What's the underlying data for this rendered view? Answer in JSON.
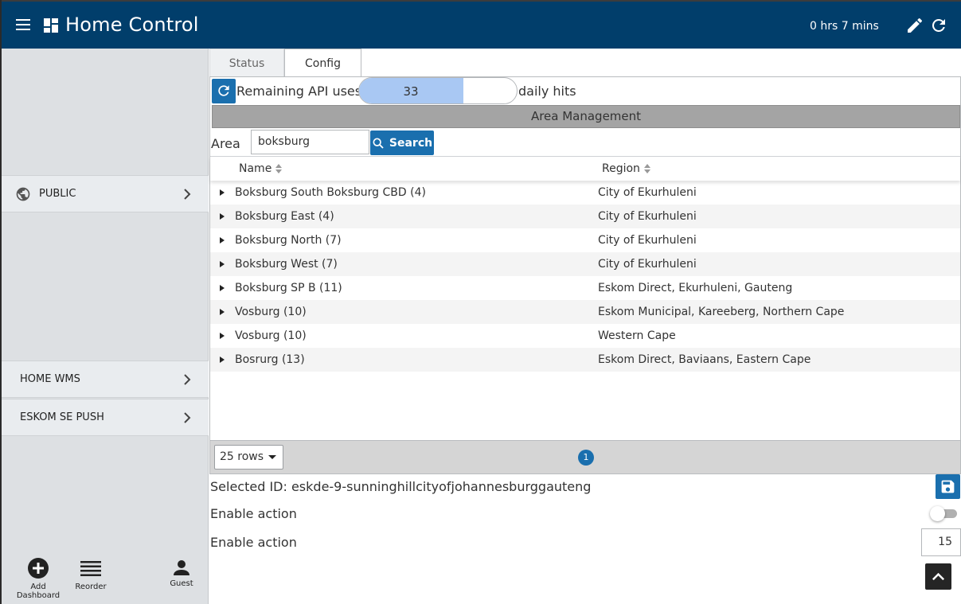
{
  "header": {
    "title": "Home Control",
    "timer": "0 hrs 7 mins",
    "icons": [
      "menu-icon",
      "dashboard-icon",
      "pencil-icon",
      "refresh-icon"
    ]
  },
  "sidebar": {
    "items": [
      {
        "label": "PUBLIC",
        "icon": "globe-icon"
      },
      {
        "label": "HOME WMS"
      },
      {
        "label": "ESKOM SE PUSH"
      }
    ],
    "tools": [
      {
        "label": "Add Dashboard",
        "icon": "add-circle-icon"
      },
      {
        "label": "Reorder",
        "icon": "reorder-icon"
      },
      {
        "label": "Guest",
        "icon": "person-icon"
      }
    ]
  },
  "tabs": [
    {
      "label": "Status",
      "active": false
    },
    {
      "label": "Config",
      "active": true
    }
  ],
  "api": {
    "label": "Remaining API uses:",
    "value": "33",
    "fill_fraction": 0.66,
    "suffix": "daily hits"
  },
  "area": {
    "header": "Area Management",
    "label": "Area",
    "input_value": "boksburg",
    "search_label": "Search"
  },
  "table": {
    "columns": [
      "Name",
      "Region"
    ],
    "rows": [
      {
        "name": "Boksburg South Boksburg CBD (4)",
        "region": "City of Ekurhuleni"
      },
      {
        "name": "Boksburg East (4)",
        "region": "City of Ekurhuleni"
      },
      {
        "name": "Boksburg North (7)",
        "region": "City of Ekurhuleni"
      },
      {
        "name": "Boksburg West (7)",
        "region": "City of Ekurhuleni"
      },
      {
        "name": "Boksburg SP B (11)",
        "region": "Eskom Direct, Ekurhuleni, Gauteng"
      },
      {
        "name": "Vosburg (10)",
        "region": "Eskom Municipal, Kareeberg, Northern Cape"
      },
      {
        "name": "Vosburg (10)",
        "region": "Western Cape"
      },
      {
        "name": "Bosrurg (13)",
        "region": "Eskom Direct, Baviaans, Eastern Cape"
      }
    ]
  },
  "pager": {
    "rows_label": "25 rows",
    "page": "1"
  },
  "config": {
    "selected_id": "Selected ID: eskde-9-sunninghillcityofjohannesburggauteng",
    "enable_label_1": "Enable action",
    "enable_label_2": "Enable action",
    "toggle_on": false,
    "number_value": "15"
  },
  "colors": {
    "header_bg": "#013e6b",
    "accent": "#1a6fae",
    "api_fill": "#a9c8f3"
  }
}
